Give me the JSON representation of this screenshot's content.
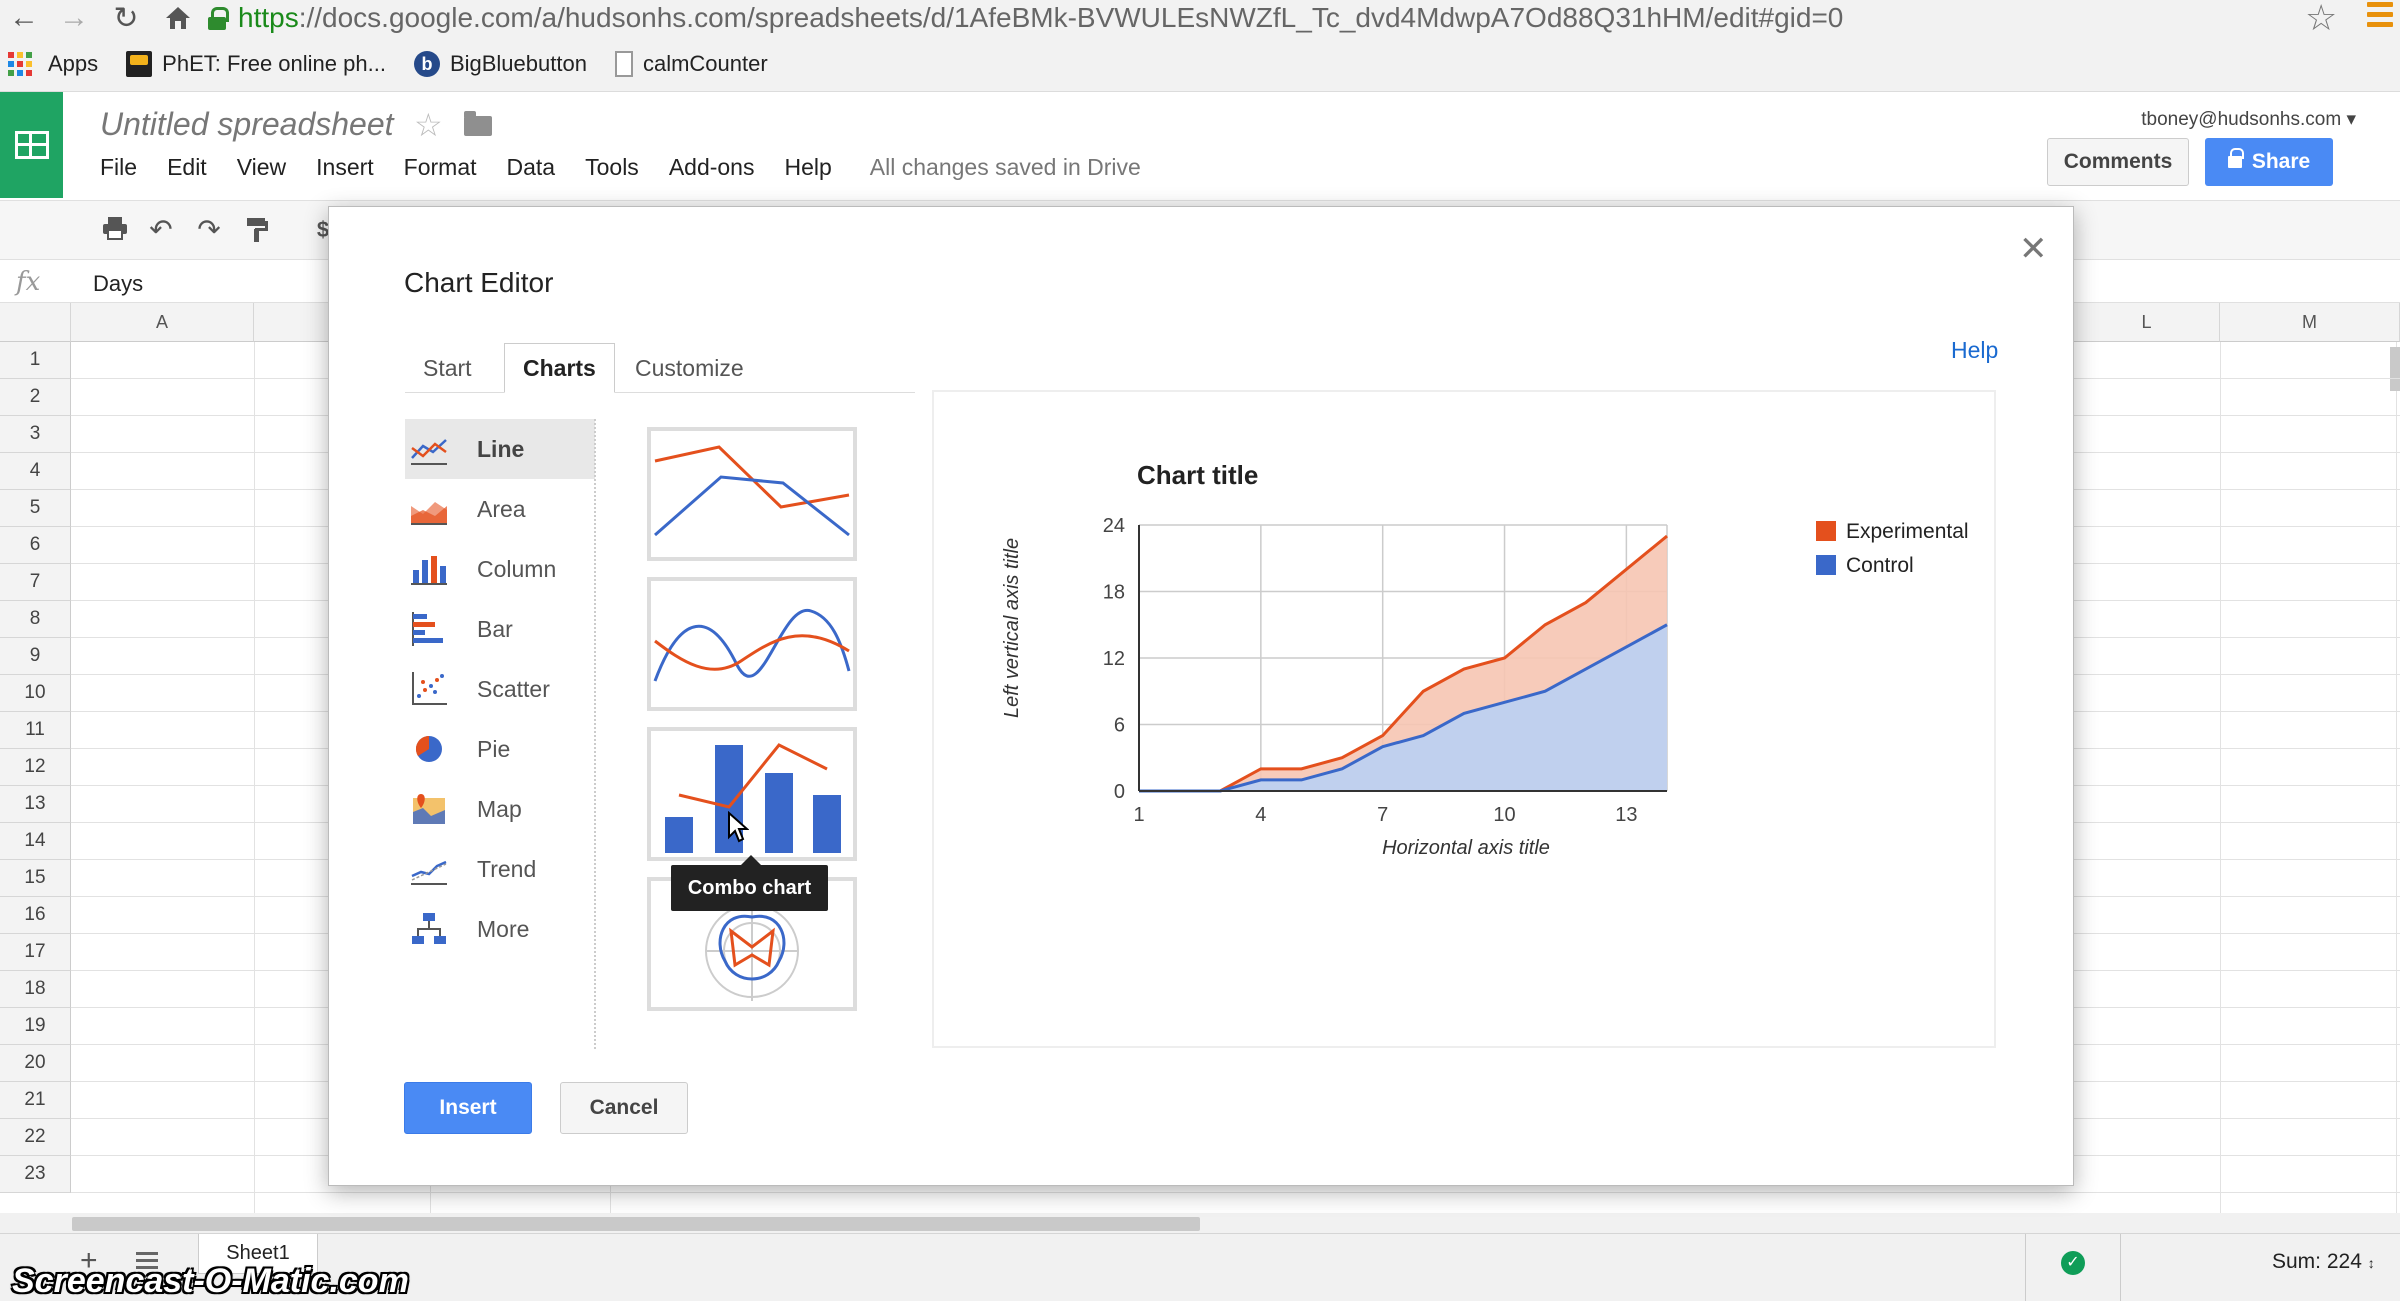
{
  "browser": {
    "url_https": "https",
    "url_rest": "://docs.google.com/a/hudsonhs.com/spreadsheets/d/1AfeBMk-BVWULEsNWZfL_Tc_dvd4MdwpA7Od88Q31hHM/edit#gid=0",
    "bookmarks": [
      {
        "label": "Apps",
        "icon": "apps-grid-icon"
      },
      {
        "label": "PhET: Free online ph...",
        "icon": "phet-icon"
      },
      {
        "label": "BigBluebutton",
        "icon": "bigbluebutton-icon"
      },
      {
        "label": "calmCounter",
        "icon": "page-icon"
      }
    ]
  },
  "sheets": {
    "doc_title": "Untitled spreadsheet",
    "account": "tboney@hudsonhs.com ▾",
    "comments_label": "Comments",
    "share_label": "Share",
    "menu": [
      "File",
      "Edit",
      "View",
      "Insert",
      "Format",
      "Data",
      "Tools",
      "Add-ons",
      "Help"
    ],
    "saved_status": "All changes saved in Drive",
    "fx_label": "fx",
    "formula_value": "Days",
    "columns": [
      "A",
      "L",
      "M"
    ],
    "rows": [
      "1",
      "2",
      "3",
      "4",
      "5",
      "6",
      "7",
      "8",
      "9",
      "10",
      "11",
      "12",
      "13",
      "14",
      "15",
      "16",
      "17",
      "18",
      "19",
      "20",
      "21",
      "22",
      "23"
    ],
    "sheet_tab": "Sheet1",
    "sum_label": "Sum: 224",
    "watermark": "Screencast-O-Matic.com"
  },
  "editor": {
    "title": "Chart Editor",
    "help_label": "Help",
    "close_icon": "close-icon",
    "tabs": [
      {
        "label": "Start",
        "active": false
      },
      {
        "label": "Charts",
        "active": true
      },
      {
        "label": "Customize",
        "active": false
      }
    ],
    "chart_types": [
      {
        "label": "Line",
        "icon": "line-chart-icon",
        "active": true
      },
      {
        "label": "Area",
        "icon": "area-chart-icon",
        "active": false
      },
      {
        "label": "Column",
        "icon": "column-chart-icon",
        "active": false
      },
      {
        "label": "Bar",
        "icon": "bar-chart-icon",
        "active": false
      },
      {
        "label": "Scatter",
        "icon": "scatter-chart-icon",
        "active": false
      },
      {
        "label": "Pie",
        "icon": "pie-chart-icon",
        "active": false
      },
      {
        "label": "Map",
        "icon": "map-chart-icon",
        "active": false
      },
      {
        "label": "Trend",
        "icon": "trend-chart-icon",
        "active": false
      },
      {
        "label": "More",
        "icon": "more-chart-icon",
        "active": false
      }
    ],
    "tooltip": "Combo chart",
    "insert_label": "Insert",
    "cancel_label": "Cancel"
  },
  "colors": {
    "experimental": "#e4501d",
    "control": "#3a68c9",
    "experimental_fill": "#f6c5b2",
    "control_fill": "#c0d0ee",
    "accent_blue": "#4a8af4",
    "sheets_green": "#1fa463"
  },
  "chart_data": {
    "type": "area",
    "title": "Chart title",
    "xlabel": "Horizontal axis title",
    "ylabel": "Left vertical axis title",
    "x": [
      1,
      2,
      3,
      4,
      5,
      6,
      7,
      8,
      9,
      10,
      11,
      12,
      13,
      14
    ],
    "x_ticks": [
      1,
      4,
      7,
      10,
      13
    ],
    "y_ticks": [
      0,
      6,
      12,
      18,
      24
    ],
    "xlim": [
      1,
      14
    ],
    "ylim": [
      0,
      24
    ],
    "grid": true,
    "legend_position": "right",
    "stacked": true,
    "series": [
      {
        "name": "Control",
        "values": [
          0,
          0,
          0,
          1,
          1,
          2,
          4,
          5,
          7,
          8,
          9,
          11,
          13,
          15
        ]
      },
      {
        "name": "Experimental",
        "values": [
          0,
          0,
          0,
          2,
          2,
          3,
          5,
          9,
          11,
          12,
          15,
          17,
          20,
          23
        ]
      }
    ]
  }
}
